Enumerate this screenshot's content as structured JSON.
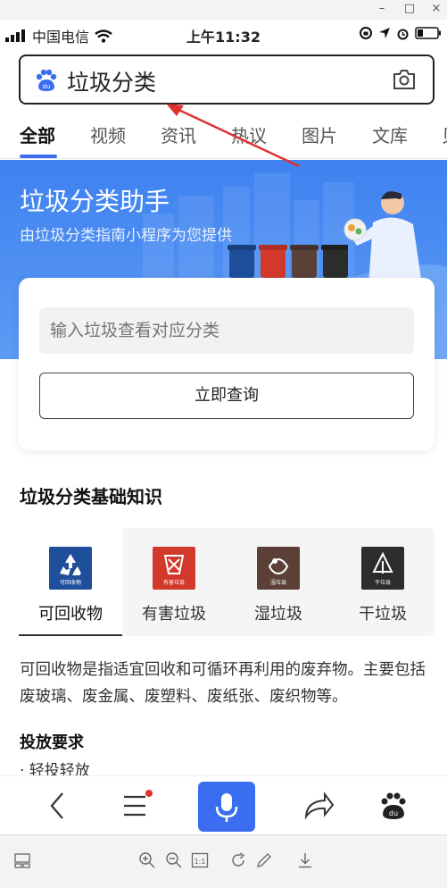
{
  "window": {
    "min": "–",
    "max": "□",
    "close": "×"
  },
  "status": {
    "carrier": "中国电信",
    "time": "上午11:32"
  },
  "search": {
    "query": "垃圾分类"
  },
  "tabs": [
    "全部",
    "视频",
    "资讯",
    "热议",
    "图片",
    "文库",
    "贝"
  ],
  "banner": {
    "title": "垃圾分类助手",
    "subtitle": "由垃圾分类指南小程序为您提供"
  },
  "card": {
    "placeholder": "输入垃圾查看对应分类",
    "button": "立即查询"
  },
  "section": {
    "title": "垃圾分类基础知识",
    "categories": [
      {
        "name": "可回收物",
        "color": "#1f4e9a",
        "sign": "可回收物"
      },
      {
        "name": "有害垃圾",
        "color": "#d2392b",
        "sign": "有害垃圾"
      },
      {
        "name": "湿垃圾",
        "color": "#5a4036",
        "sign": "湿垃圾"
      },
      {
        "name": "干垃圾",
        "color": "#2c2c2c",
        "sign": "干垃圾"
      }
    ],
    "description": "可回收物是指适宜回收和可循环再利用的废弃物。主要包括废玻璃、废金属、废塑料、废纸张、废织物等。",
    "requirements_title": "投放要求",
    "requirement_1": "· 轻投轻放"
  },
  "colors": {
    "accent": "#3a6df0",
    "annotation": "#e03131"
  }
}
